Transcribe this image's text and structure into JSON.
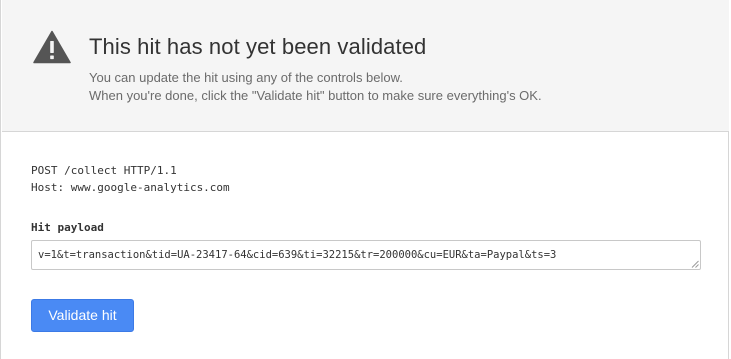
{
  "banner": {
    "icon": "warning-triangle-icon",
    "title": "This hit has not yet been validated",
    "line1": "You can update the hit using any of the controls below.",
    "line2": "When you're done, click the \"Validate hit\" button to make sure everything's OK."
  },
  "request": {
    "line1": "POST /collect HTTP/1.1",
    "line2": "Host: www.google-analytics.com"
  },
  "payload": {
    "label": "Hit payload",
    "value": "v=1&t=transaction&tid=UA-23417-64&cid=639&ti=32215&tr=200000&cu=EUR&ta=Paypal&ts=3"
  },
  "actions": {
    "validate_label": "Validate hit"
  },
  "colors": {
    "banner_bg": "#f5f5f5",
    "button_bg": "#4a8af4",
    "icon": "#555555"
  }
}
